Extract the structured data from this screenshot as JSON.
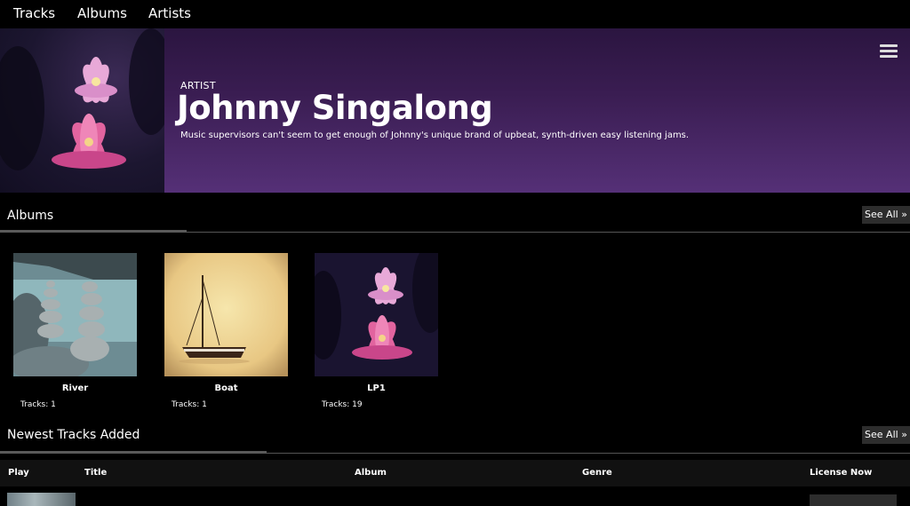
{
  "nav": {
    "items": [
      "Tracks",
      "Albums",
      "Artists"
    ]
  },
  "hero": {
    "kicker": "ARTIST",
    "title": "Johnny Singalong",
    "description": "Music supervisors can't seem to get enough of Johnny's unique brand of upbeat, synth-driven easy listening jams."
  },
  "albums_section": {
    "title": "Albums",
    "see_all": "See All »",
    "albums": [
      {
        "name": "River",
        "tracks": "Tracks: 1"
      },
      {
        "name": "Boat",
        "tracks": "Tracks: 1"
      },
      {
        "name": "LP1",
        "tracks": "Tracks: 19"
      }
    ]
  },
  "tracks_section": {
    "title": "Newest Tracks Added",
    "see_all": "See All »",
    "columns": [
      "Play",
      "Title",
      "Album",
      "Genre",
      "License Now"
    ]
  },
  "colors": {
    "hero_top": "#2b1540",
    "hero_bottom": "#553077",
    "background": "#000000",
    "button_bg": "#2d2d2d"
  }
}
